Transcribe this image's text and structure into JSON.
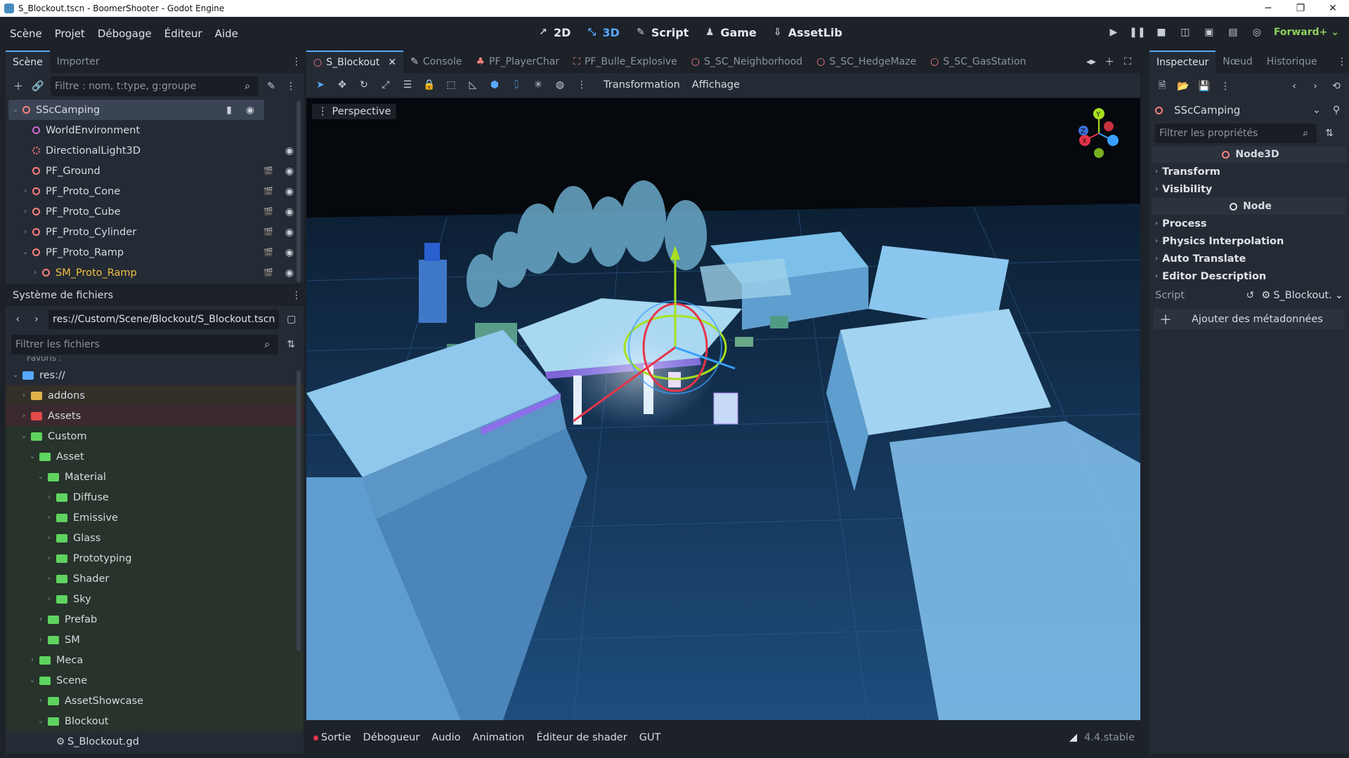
{
  "window": {
    "title": "S_Blockout.tscn - BoomerShooter - Godot Engine",
    "minimize": "─",
    "maximize": "❐",
    "close": "✕"
  },
  "menus": [
    "Scène",
    "Projet",
    "Débogage",
    "Éditeur",
    "Aide"
  ],
  "modes": [
    {
      "label": "2D",
      "icon": "2d-icon"
    },
    {
      "label": "3D",
      "icon": "3d-icon"
    },
    {
      "label": "Script",
      "icon": "script-icon"
    },
    {
      "label": "Game",
      "icon": "game-icon"
    },
    {
      "label": "AssetLib",
      "icon": "assetlib-icon"
    }
  ],
  "renderer": "Forward+",
  "scene_dock": {
    "tabs": [
      "Scène",
      "Importer"
    ],
    "filter_placeholder": "Filtre : nom, t:type, g:groupe",
    "nodes": [
      {
        "label": "SScCamping",
        "depth": 0,
        "arrow": "⌄",
        "selected": true
      },
      {
        "label": "WorldEnvironment",
        "depth": 1,
        "arrow": ""
      },
      {
        "label": "DirectionalLight3D",
        "depth": 1,
        "arrow": ""
      },
      {
        "label": "PF_Ground",
        "depth": 1,
        "arrow": ""
      },
      {
        "label": "PF_Proto_Cone",
        "depth": 1,
        "arrow": "›"
      },
      {
        "label": "PF_Proto_Cube",
        "depth": 1,
        "arrow": "›"
      },
      {
        "label": "PF_Proto_Cylinder",
        "depth": 1,
        "arrow": "›"
      },
      {
        "label": "PF_Proto_Ramp",
        "depth": 1,
        "arrow": "⌄"
      },
      {
        "label": "SM_Proto_Ramp",
        "depth": 2,
        "arrow": "›"
      }
    ]
  },
  "filesystem_dock": {
    "title": "Système de fichiers",
    "path": "res://Custom/Scene/Blockout/S_Blockout.tscn",
    "filter_placeholder": "Filtrer les fichiers",
    "partial_top": "Favoris :",
    "items": [
      {
        "label": "res://",
        "depth": 0,
        "arrow": "⌄",
        "color": "#57a8ff"
      },
      {
        "label": "addons",
        "depth": 1,
        "arrow": "›",
        "color": "#e0b44a"
      },
      {
        "label": "Assets",
        "depth": 1,
        "arrow": "›",
        "color": "#e04a4a"
      },
      {
        "label": "Custom",
        "depth": 1,
        "arrow": "⌄",
        "color": "#5fd35f"
      },
      {
        "label": "Asset",
        "depth": 2,
        "arrow": "⌄",
        "color": "#5fd35f"
      },
      {
        "label": "Material",
        "depth": 3,
        "arrow": "⌄",
        "color": "#5fd35f"
      },
      {
        "label": "Diffuse",
        "depth": 4,
        "arrow": "›",
        "color": "#5fd35f"
      },
      {
        "label": "Emissive",
        "depth": 4,
        "arrow": "›",
        "color": "#5fd35f"
      },
      {
        "label": "Glass",
        "depth": 4,
        "arrow": "›",
        "color": "#5fd35f"
      },
      {
        "label": "Prototyping",
        "depth": 4,
        "arrow": "›",
        "color": "#5fd35f"
      },
      {
        "label": "Shader",
        "depth": 4,
        "arrow": "›",
        "color": "#5fd35f"
      },
      {
        "label": "Sky",
        "depth": 4,
        "arrow": "›",
        "color": "#5fd35f"
      },
      {
        "label": "Prefab",
        "depth": 3,
        "arrow": "›",
        "color": "#5fd35f"
      },
      {
        "label": "SM",
        "depth": 3,
        "arrow": "›",
        "color": "#5fd35f"
      },
      {
        "label": "Meca",
        "depth": 2,
        "arrow": "›",
        "color": "#5fd35f"
      },
      {
        "label": "Scene",
        "depth": 2,
        "arrow": "⌄",
        "color": "#5fd35f"
      },
      {
        "label": "AssetShowcase",
        "depth": 3,
        "arrow": "›",
        "color": "#5fd35f"
      },
      {
        "label": "Blockout",
        "depth": 3,
        "arrow": "⌄",
        "color": "#5fd35f"
      },
      {
        "label": "S_Blockout.gd",
        "depth": 4,
        "arrow": "",
        "color": "gear"
      }
    ]
  },
  "editor_tabs": [
    {
      "label": "S_Blockout",
      "active": true
    },
    {
      "label": "Console"
    },
    {
      "label": "PF_PlayerChar"
    },
    {
      "label": "PF_Bulle_Explosive"
    },
    {
      "label": "S_SC_Neighborhood"
    },
    {
      "label": "S_SC_HedgeMaze"
    },
    {
      "label": "S_SC_GasStation"
    }
  ],
  "viewport_toolbar": {
    "transform_menu": "Transformation",
    "view_menu": "Affichage",
    "perspective": "Perspective"
  },
  "gizmo": {
    "x": "X",
    "y": "Y",
    "z": "Z"
  },
  "inspector": {
    "tabs": [
      "Inspecteur",
      "Nœud",
      "Historique"
    ],
    "selected_node": "SScCamping",
    "filter_placeholder": "Filtrer les propriétés",
    "sections": [
      {
        "header": "Node3D",
        "props": [
          "Transform",
          "Visibility"
        ]
      },
      {
        "header": "Node",
        "props": [
          "Process",
          "Physics Interpolation",
          "Auto Translate",
          "Editor Description"
        ]
      }
    ],
    "script_label": "Script",
    "script_value": "S_Blockout.",
    "add_metadata": "Ajouter des métadonnées"
  },
  "bottom_panel": {
    "tabs": [
      "Sortie",
      "Débogueur",
      "Audio",
      "Animation",
      "Éditeur de shader",
      "GUT"
    ],
    "version": "4.4.stable"
  }
}
